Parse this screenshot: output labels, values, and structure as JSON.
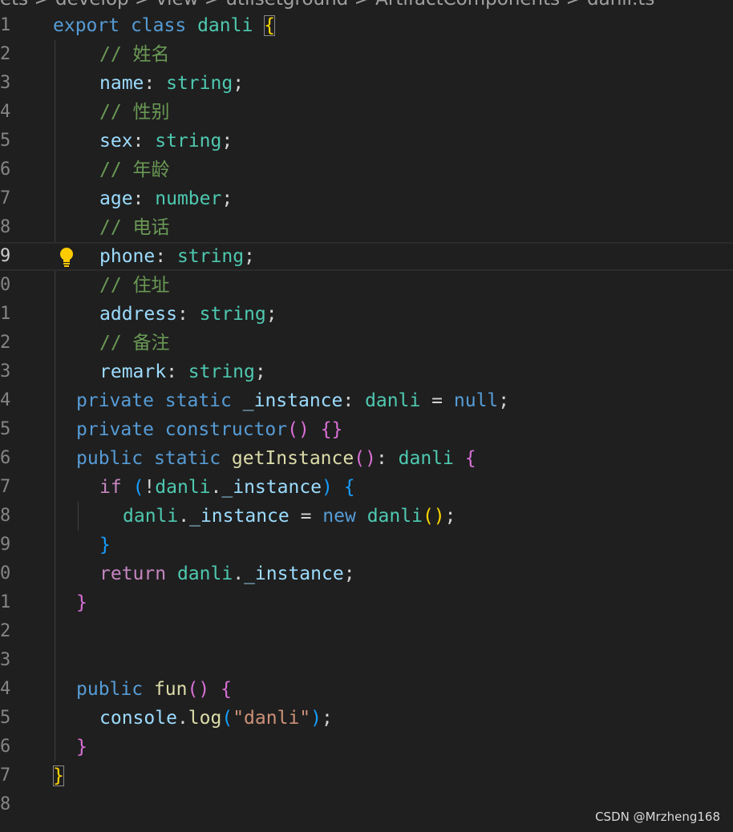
{
  "editor": {
    "breadcrumb": "ets > develop > view > utilsetground > ArtifactComponents >  danli.ts",
    "lines": [
      {
        "no": "1",
        "indent": 0,
        "guides": [],
        "tokens": [
          [
            "kw",
            "export"
          ],
          [
            "pun",
            " "
          ],
          [
            "kw",
            "class"
          ],
          [
            "pun",
            " "
          ],
          [
            "cls",
            "danli"
          ],
          [
            "pun",
            " "
          ],
          [
            "b1 match",
            "{"
          ]
        ]
      },
      {
        "no": "2",
        "indent": 2,
        "guides": [
          1
        ],
        "tokens": [
          [
            "cmt",
            "// 姓名"
          ]
        ]
      },
      {
        "no": "3",
        "indent": 2,
        "guides": [
          1
        ],
        "tokens": [
          [
            "prop",
            "name"
          ],
          [
            "pun",
            ": "
          ],
          [
            "cls",
            "string"
          ],
          [
            "pun",
            ";"
          ]
        ]
      },
      {
        "no": "4",
        "indent": 2,
        "guides": [
          1
        ],
        "tokens": [
          [
            "cmt",
            "// 性别"
          ]
        ]
      },
      {
        "no": "5",
        "indent": 2,
        "guides": [
          1
        ],
        "tokens": [
          [
            "prop",
            "sex"
          ],
          [
            "pun",
            ": "
          ],
          [
            "cls",
            "string"
          ],
          [
            "pun",
            ";"
          ]
        ]
      },
      {
        "no": "6",
        "indent": 2,
        "guides": [
          1
        ],
        "tokens": [
          [
            "cmt",
            "// 年龄"
          ]
        ]
      },
      {
        "no": "7",
        "indent": 2,
        "guides": [
          1
        ],
        "tokens": [
          [
            "prop",
            "age"
          ],
          [
            "pun",
            ": "
          ],
          [
            "cls",
            "number"
          ],
          [
            "pun",
            ";"
          ]
        ]
      },
      {
        "no": "8",
        "indent": 2,
        "guides": [
          1
        ],
        "tokens": [
          [
            "cmt",
            "// 电话"
          ]
        ]
      },
      {
        "no": "9",
        "indent": 2,
        "guides": [],
        "current": true,
        "bulb": true,
        "tokens": [
          [
            "prop",
            "phone"
          ],
          [
            "pun",
            ": "
          ],
          [
            "cls",
            "string"
          ],
          [
            "pun",
            ";"
          ]
        ]
      },
      {
        "no": "0",
        "indent": 2,
        "guides": [
          1
        ],
        "tokens": [
          [
            "cmt",
            "// 住址"
          ]
        ]
      },
      {
        "no": "1",
        "indent": 2,
        "guides": [
          1
        ],
        "tokens": [
          [
            "prop",
            "address"
          ],
          [
            "pun",
            ": "
          ],
          [
            "cls",
            "string"
          ],
          [
            "pun",
            ";"
          ]
        ]
      },
      {
        "no": "2",
        "indent": 2,
        "guides": [
          1
        ],
        "tokens": [
          [
            "cmt",
            "// 备注"
          ]
        ]
      },
      {
        "no": "3",
        "indent": 2,
        "guides": [
          1
        ],
        "tokens": [
          [
            "prop",
            "remark"
          ],
          [
            "pun",
            ": "
          ],
          [
            "cls",
            "string"
          ],
          [
            "pun",
            ";"
          ]
        ]
      },
      {
        "no": "4",
        "indent": 1,
        "guides": [
          1
        ],
        "tokens": [
          [
            "kw",
            "private"
          ],
          [
            "pun",
            " "
          ],
          [
            "kw",
            "static"
          ],
          [
            "pun",
            " "
          ],
          [
            "prop",
            "_instance"
          ],
          [
            "pun",
            ": "
          ],
          [
            "cls",
            "danli"
          ],
          [
            "pun",
            " = "
          ],
          [
            "kw",
            "null"
          ],
          [
            "pun",
            ";"
          ]
        ]
      },
      {
        "no": "5",
        "indent": 1,
        "guides": [
          1
        ],
        "tokens": [
          [
            "kw",
            "private"
          ],
          [
            "pun",
            " "
          ],
          [
            "kw",
            "constructor"
          ],
          [
            "b2",
            "()"
          ],
          [
            "pun",
            " "
          ],
          [
            "b2",
            "{}"
          ]
        ]
      },
      {
        "no": "6",
        "indent": 1,
        "guides": [
          1
        ],
        "tokens": [
          [
            "kw",
            "public"
          ],
          [
            "pun",
            " "
          ],
          [
            "kw",
            "static"
          ],
          [
            "pun",
            " "
          ],
          [
            "fn",
            "getInstance"
          ],
          [
            "b2",
            "()"
          ],
          [
            "pun",
            ": "
          ],
          [
            "cls",
            "danli"
          ],
          [
            "pun",
            " "
          ],
          [
            "b2",
            "{"
          ]
        ]
      },
      {
        "no": "7",
        "indent": 2,
        "guides": [
          1
        ],
        "tokens": [
          [
            "ctrl",
            "if"
          ],
          [
            "pun",
            " "
          ],
          [
            "b3",
            "("
          ],
          [
            "pun",
            "!"
          ],
          [
            "cls",
            "danli"
          ],
          [
            "pun",
            "."
          ],
          [
            "prop",
            "_instance"
          ],
          [
            "b3",
            ")"
          ],
          [
            "pun",
            " "
          ],
          [
            "b3",
            "{"
          ]
        ]
      },
      {
        "no": "8",
        "indent": 3,
        "guides": [
          1,
          2
        ],
        "tokens": [
          [
            "cls",
            "danli"
          ],
          [
            "pun",
            "."
          ],
          [
            "prop",
            "_instance"
          ],
          [
            "pun",
            " = "
          ],
          [
            "kw",
            "new"
          ],
          [
            "pun",
            " "
          ],
          [
            "cls",
            "danli"
          ],
          [
            "b1",
            "()"
          ],
          [
            "pun",
            ";"
          ]
        ]
      },
      {
        "no": "9",
        "indent": 2,
        "guides": [
          1
        ],
        "tokens": [
          [
            "b3",
            "}"
          ]
        ]
      },
      {
        "no": "0",
        "indent": 2,
        "guides": [
          1
        ],
        "tokens": [
          [
            "ctrl",
            "return"
          ],
          [
            "pun",
            " "
          ],
          [
            "cls",
            "danli"
          ],
          [
            "pun",
            "."
          ],
          [
            "prop",
            "_instance"
          ],
          [
            "pun",
            ";"
          ]
        ]
      },
      {
        "no": "1",
        "indent": 1,
        "guides": [
          1
        ],
        "tokens": [
          [
            "b2",
            "}"
          ]
        ]
      },
      {
        "no": "2",
        "indent": 0,
        "guides": [
          1
        ],
        "tokens": []
      },
      {
        "no": "3",
        "indent": 0,
        "guides": [
          1
        ],
        "tokens": []
      },
      {
        "no": "4",
        "indent": 1,
        "guides": [
          1
        ],
        "tokens": [
          [
            "kw",
            "public"
          ],
          [
            "pun",
            " "
          ],
          [
            "fn",
            "fun"
          ],
          [
            "b2",
            "()"
          ],
          [
            "pun",
            " "
          ],
          [
            "b2",
            "{"
          ]
        ]
      },
      {
        "no": "5",
        "indent": 2,
        "guides": [
          1
        ],
        "tokens": [
          [
            "prop",
            "console"
          ],
          [
            "pun",
            "."
          ],
          [
            "fn",
            "log"
          ],
          [
            "b3",
            "("
          ],
          [
            "str",
            "\"danli\""
          ],
          [
            "b3",
            ")"
          ],
          [
            "pun",
            ";"
          ]
        ]
      },
      {
        "no": "6",
        "indent": 1,
        "guides": [
          1
        ],
        "tokens": [
          [
            "b2",
            "}"
          ]
        ]
      },
      {
        "no": "7",
        "indent": 0,
        "guides": [],
        "tokens": [
          [
            "b1 match",
            "}"
          ]
        ]
      },
      {
        "no": "8",
        "indent": 0,
        "guides": [],
        "tokens": []
      }
    ]
  },
  "watermark": "CSDN @Mrzheng168",
  "icons": {
    "lightbulb": "lightbulb-icon"
  },
  "colors": {
    "background": "#1f1f1f",
    "keyword": "#569cd6",
    "type": "#4ec9b0",
    "comment": "#6a9955"
  }
}
